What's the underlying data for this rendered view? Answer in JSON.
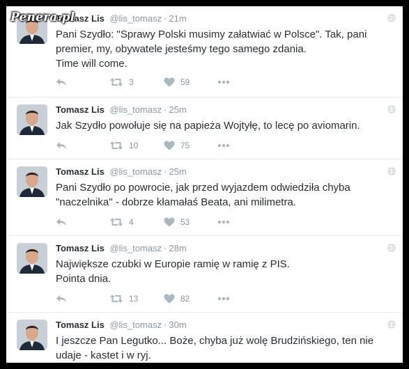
{
  "watermark": "Penera.pl",
  "tweets": [
    {
      "name": "Tomasz Lis",
      "handle": "@lis_tomasz",
      "time": "21m",
      "lines": [
        "Pani Szydło: \"Sprawy Polski musimy załatwiać w Polsce\". Tak, pani",
        "premier, my, obywatele jesteśmy tego samego zdania.",
        "Time will come."
      ],
      "retweets": "3",
      "likes": "59"
    },
    {
      "name": "Tomasz Lis",
      "handle": "@lis_tomasz",
      "time": "25m",
      "lines": [
        "Jak Szydło powołuje się na papieża Wojtyłę, to lecę po aviomarin."
      ],
      "retweets": "10",
      "likes": "75"
    },
    {
      "name": "Tomasz Lis",
      "handle": "@lis_tomasz",
      "time": "25m",
      "lines": [
        "Pani Szydło po powrocie, jak przed wyjazdem odwiedziła chyba",
        "\"naczelnika\" - dobrze kłamałaś Beata, ani milimetra."
      ],
      "retweets": "4",
      "likes": "53"
    },
    {
      "name": "Tomasz Lis",
      "handle": "@lis_tomasz",
      "time": "28m",
      "lines": [
        "Największe czubki w Europie ramię w ramię z PIS.",
        "Pointa dnia."
      ],
      "retweets": "13",
      "likes": "82"
    },
    {
      "name": "Tomasz Lis",
      "handle": "@lis_tomasz",
      "time": "30m",
      "lines": [
        "I jeszcze Pan Legutko... Boże, chyba już wolę Brudzińskiego, ten nie",
        "udaje - kastet i w ryj."
      ],
      "retweets": "",
      "likes": ""
    }
  ],
  "colors": {
    "text": "#292f33",
    "muted": "#8899a6",
    "border": "#e6ecf0"
  }
}
